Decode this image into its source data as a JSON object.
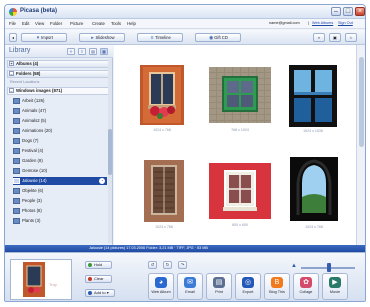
{
  "window": {
    "title": "Picasa (beta)"
  },
  "menu": [
    "File",
    "Edit",
    "View",
    "Folder",
    "Picture",
    "Create",
    "Tools",
    "Help"
  ],
  "account": {
    "email": "name@gmail.com",
    "separator": "|",
    "links": [
      "Web Albums",
      "Sign Out"
    ]
  },
  "toolbar": {
    "import": "Import",
    "slideshow": "Slideshow",
    "timeline": "Timeline",
    "gift_cd": "Gift CD"
  },
  "library": {
    "title": "Library",
    "albums": "Albums (4)",
    "folders": "Folders (58)",
    "subhead": "Recent Locations",
    "parent": "Windows images (871)",
    "items": [
      "Arbeit (126)",
      "Animals (47)",
      "Animals2 (5)",
      "Animations (20)",
      "Dogs (7)",
      "Festival (4)",
      "Garden (8)",
      "Gemüse (10)",
      "Jalousie (14)",
      "Objekte (6)",
      "People (3)",
      "Photos (8)",
      "Plants (3)"
    ],
    "selected_index": 8
  },
  "photos": [
    {
      "caption": "1024 x 768"
    },
    {
      "caption": "768 x 1024"
    },
    {
      "caption": "1024 x 1536"
    },
    {
      "caption": "1024 x 768"
    },
    {
      "caption": "800 x 600"
    },
    {
      "caption": "1024 x 768"
    }
  ],
  "status": {
    "text": "Jalousie (14 pictures)   17.03.2006   Folder: 3,21 MB  · TIFF, JPG  · 53 MB"
  },
  "tray": {
    "hold": "Hold",
    "clear": "Clear",
    "add_to": "Add to",
    "actions": [
      "Web Album",
      "Email",
      "Print",
      "Export",
      "Blog This",
      "Collage",
      "Movie"
    ]
  }
}
